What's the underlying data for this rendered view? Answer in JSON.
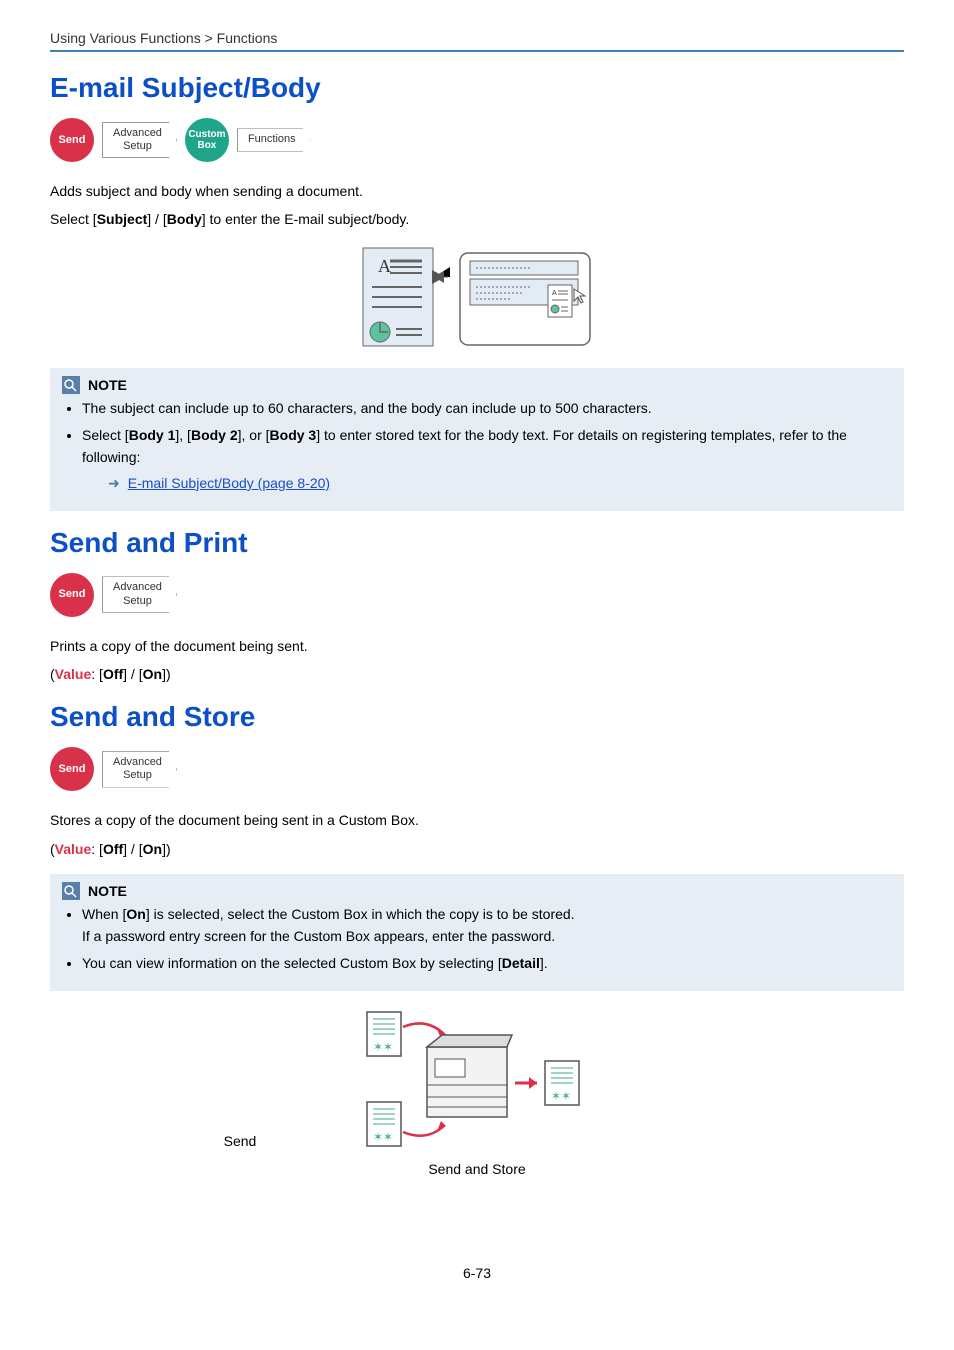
{
  "breadcrumb": "Using Various Functions > Functions",
  "section1": {
    "title": "E-mail Subject/Body",
    "pills": {
      "send": "Send",
      "adv_line1": "Advanced",
      "adv_line2": "Setup",
      "custom_line1": "Custom",
      "custom_line2": "Box",
      "functions": "Functions"
    },
    "line1": "Adds subject and body when sending a document.",
    "line2_pre": "Select [",
    "line2_subject": "Subject",
    "line2_mid": "] / [",
    "line2_body": "Body",
    "line2_post": "] to enter the E-mail subject/body.",
    "note_label": "NOTE",
    "note1": "The subject can include up to 60 characters, and the body can include up to 500 characters.",
    "note2_pre": "Select [",
    "note2_b1": "Body 1",
    "note2_mid1": "], [",
    "note2_b2": "Body 2",
    "note2_mid2": "], or [",
    "note2_b3": "Body 3",
    "note2_post": "] to enter stored text for the body text. For details on registering templates, refer to the following:",
    "xref": "E-mail Subject/Body (page 8-20)"
  },
  "section2": {
    "title": "Send and Print",
    "pills": {
      "send": "Send",
      "adv_line1": "Advanced",
      "adv_line2": "Setup"
    },
    "line1": "Prints a copy of the document being sent.",
    "valline_open": "(",
    "valline_value": "Value",
    "valline_mid1": ": [",
    "valline_off": "Off",
    "valline_mid2": "] / [",
    "valline_on": "On",
    "valline_close": "])"
  },
  "section3": {
    "title": "Send and Store",
    "pills": {
      "send": "Send",
      "adv_line1": "Advanced",
      "adv_line2": "Setup"
    },
    "line1": "Stores a copy of the document being sent in a Custom Box.",
    "valline_open": "(",
    "valline_value": "Value",
    "valline_mid1": ": [",
    "valline_off": "Off",
    "valline_mid2": "] / [",
    "valline_on": "On",
    "valline_close": "])",
    "note_label": "NOTE",
    "note1_pre": "When [",
    "note1_on": "On",
    "note1_post": "] is selected, select the Custom Box in which the copy is to be stored.",
    "note1_line2": "If a password entry screen for the Custom Box appears, enter the password.",
    "note2_pre": "You can view information on the selected Custom Box by selecting [",
    "note2_detail": "Detail",
    "note2_post": "].",
    "diag_send": "Send",
    "diag_sendstore": "Send and Store"
  },
  "pagenum": "6-73"
}
